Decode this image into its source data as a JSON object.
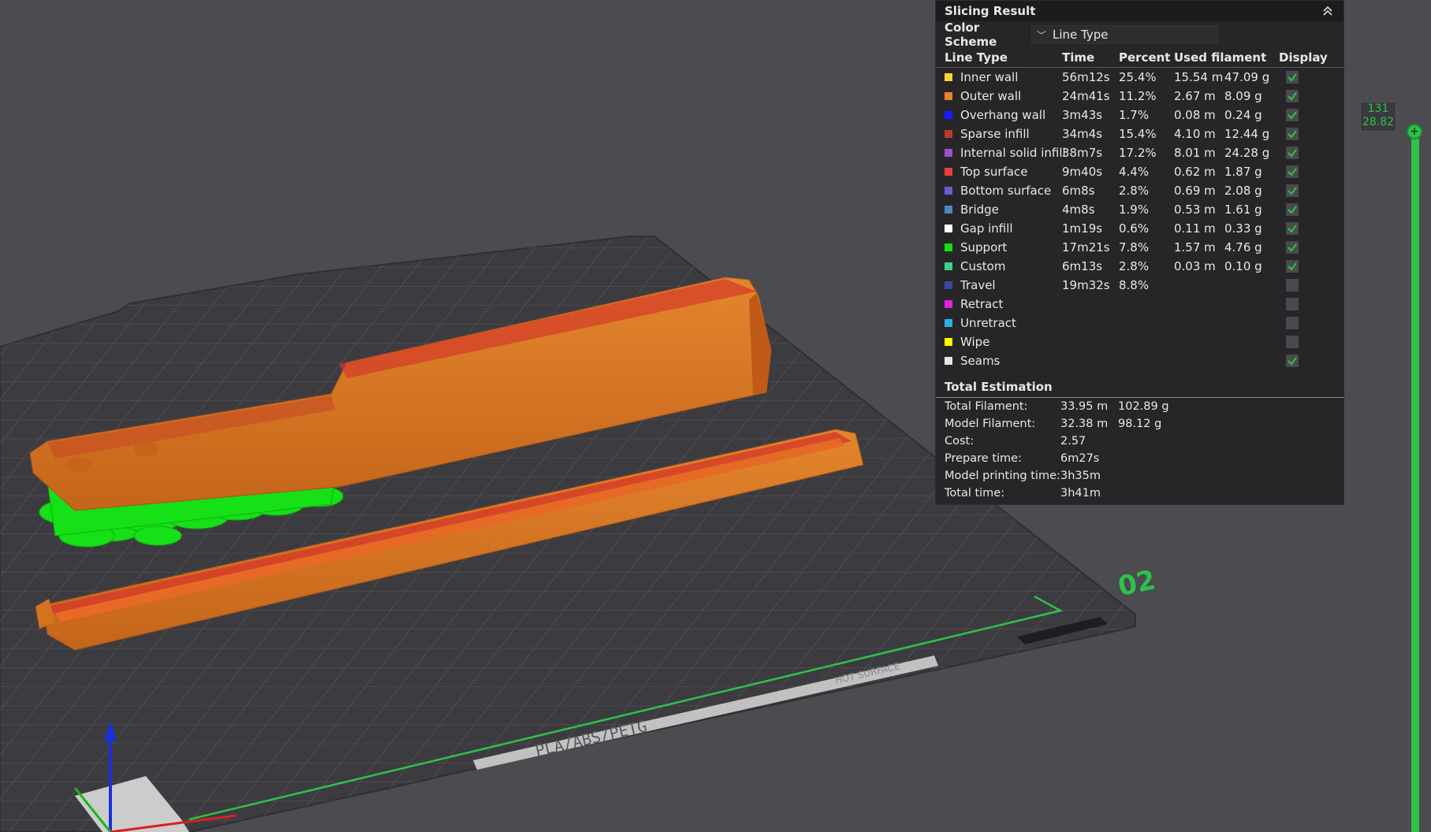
{
  "panel": {
    "title": "Slicing Result",
    "color_scheme_label": "Color Scheme",
    "color_scheme_value": "Line Type",
    "columns": {
      "type": "Line Type",
      "time": "Time",
      "percent": "Percent",
      "used": "Used filament",
      "display": "Display"
    },
    "rows": [
      {
        "name": "Inner wall",
        "color": "#f5d33c",
        "time": "56m12s",
        "percent": "25.4%",
        "length": "15.54 m",
        "weight": "47.09 g",
        "display": true
      },
      {
        "name": "Outer wall",
        "color": "#f0802d",
        "time": "24m41s",
        "percent": "11.2%",
        "length": "2.67 m",
        "weight": "8.09 g",
        "display": true
      },
      {
        "name": "Overhang wall",
        "color": "#1a1aff",
        "time": "3m43s",
        "percent": "1.7%",
        "length": "0.08 m",
        "weight": "0.24 g",
        "display": true
      },
      {
        "name": "Sparse infill",
        "color": "#c0392b",
        "time": "34m4s",
        "percent": "15.4%",
        "length": "4.10 m",
        "weight": "12.44 g",
        "display": true
      },
      {
        "name": "Internal solid infill",
        "color": "#9b4fc8",
        "time": "38m7s",
        "percent": "17.2%",
        "length": "8.01 m",
        "weight": "24.28 g",
        "display": true
      },
      {
        "name": "Top surface",
        "color": "#e84040",
        "time": "9m40s",
        "percent": "4.4%",
        "length": "0.62 m",
        "weight": "1.87 g",
        "display": true
      },
      {
        "name": "Bottom surface",
        "color": "#6a5cd0",
        "time": "6m8s",
        "percent": "2.8%",
        "length": "0.69 m",
        "weight": "2.08 g",
        "display": true
      },
      {
        "name": "Bridge",
        "color": "#4f84c4",
        "time": "4m8s",
        "percent": "1.9%",
        "length": "0.53 m",
        "weight": "1.61 g",
        "display": true
      },
      {
        "name": "Gap infill",
        "color": "#ffffff",
        "time": "1m19s",
        "percent": "0.6%",
        "length": "0.11 m",
        "weight": "0.33 g",
        "display": true
      },
      {
        "name": "Support",
        "color": "#11e011",
        "time": "17m21s",
        "percent": "7.8%",
        "length": "1.57 m",
        "weight": "4.76 g",
        "display": true
      },
      {
        "name": "Custom",
        "color": "#3fcf8e",
        "time": "6m13s",
        "percent": "2.8%",
        "length": "0.03 m",
        "weight": "0.10 g",
        "display": true
      },
      {
        "name": "Travel",
        "color": "#3a4aa0",
        "time": "19m32s",
        "percent": "8.8%",
        "length": "",
        "weight": "",
        "display": false
      },
      {
        "name": "Retract",
        "color": "#e020e0",
        "time": "",
        "percent": "",
        "length": "",
        "weight": "",
        "display": false
      },
      {
        "name": "Unretract",
        "color": "#2ab0e0",
        "time": "",
        "percent": "",
        "length": "",
        "weight": "",
        "display": false
      },
      {
        "name": "Wipe",
        "color": "#ffff00",
        "time": "",
        "percent": "",
        "length": "",
        "weight": "",
        "display": false
      },
      {
        "name": "Seams",
        "color": "#e6e6e6",
        "time": "",
        "percent": "",
        "length": "",
        "weight": "",
        "display": true
      }
    ],
    "total_title": "Total Estimation",
    "estimation": [
      {
        "label": "Total Filament:",
        "v1": "33.95 m",
        "v2": "102.89 g"
      },
      {
        "label": "Model Filament:",
        "v1": "32.38 m",
        "v2": "98.12 g"
      },
      {
        "label": "Cost:",
        "v1": "2.57",
        "v2": ""
      },
      {
        "label": "Prepare time:",
        "v1": "6m27s",
        "v2": ""
      },
      {
        "label": "Model printing time:",
        "v1": "3h35m",
        "v2": ""
      },
      {
        "label": "Total time:",
        "v1": "3h41m",
        "v2": ""
      }
    ]
  },
  "layer_slider": {
    "layer": "131",
    "height": "28.82",
    "handle": "+"
  },
  "plate": {
    "label": "02",
    "material_text": "PLA/ABS/PETG",
    "surface_text": "HOT SURFACE"
  },
  "colors": {
    "accent": "#2ec24a",
    "model": "#d4721e",
    "support": "#11e011",
    "background": "#4b4b50"
  }
}
